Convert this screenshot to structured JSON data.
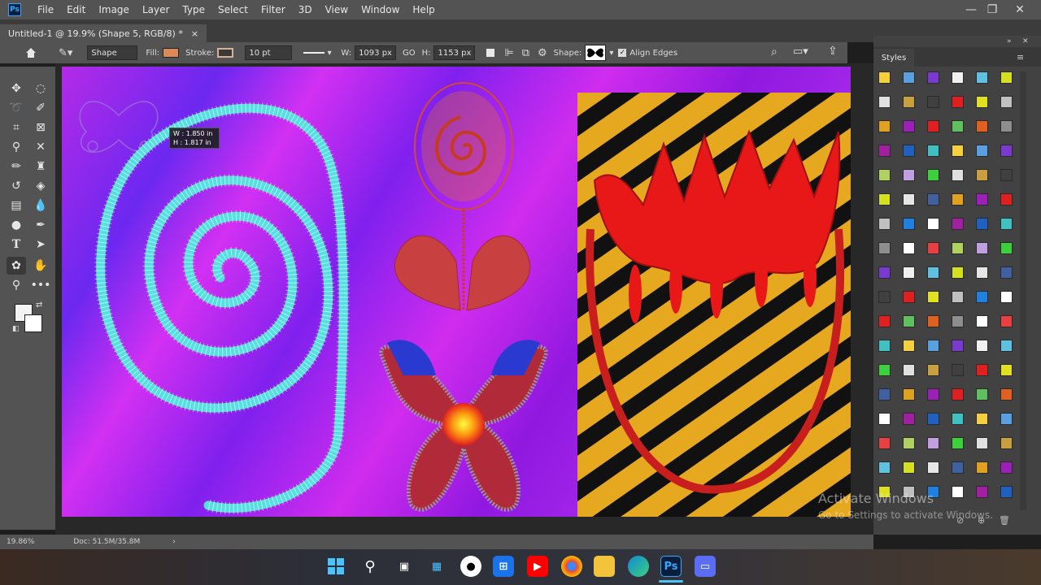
{
  "app": {
    "logo": "Ps"
  },
  "menu": [
    "File",
    "Edit",
    "Image",
    "Layer",
    "Type",
    "Select",
    "Filter",
    "3D",
    "View",
    "Window",
    "Help"
  ],
  "window_controls": {
    "minimize": "—",
    "restore": "❐",
    "close": "✕"
  },
  "document_tab": {
    "title": "Untitled-1 @ 19.9% (Shape 5, RGB/8) *",
    "close": "×"
  },
  "options": {
    "mode": "Shape",
    "fill_label": "Fill:",
    "fill_color": "#d98a5a",
    "stroke_label": "Stroke:",
    "stroke_width": "10 pt",
    "w_label": "W:",
    "w_value": "1093 px",
    "link": "GO",
    "h_label": "H:",
    "h_value": "1153 px",
    "shape_label": "Shape:",
    "align_edges": "Align Edges",
    "align_edges_checked": true
  },
  "transform_tooltip": {
    "w": "W :   1.850 in",
    "h": "H :   1.817 in"
  },
  "status": {
    "zoom": "19.86%",
    "doc": "Doc: 51.5M/35.8M"
  },
  "panel": {
    "title": "Styles"
  },
  "watermark": {
    "line1": "Activate Windows",
    "line2": "Go to Settings to activate Windows."
  },
  "taskbar": {
    "icons": [
      "windows-start-icon",
      "search-icon",
      "task-view-icon",
      "widgets-icon",
      "github-icon",
      "store-icon",
      "youtube-icon",
      "chrome-icon",
      "file-explorer-icon",
      "edge-icon",
      "photoshop-icon",
      "app-icon"
    ],
    "ps_label": "Ps"
  },
  "colors": {
    "accent": "#31a8ff",
    "canvas_purple": "#9a1aee",
    "spiral": "#5ee6e0",
    "stripe_yellow": "#e8a51c"
  }
}
